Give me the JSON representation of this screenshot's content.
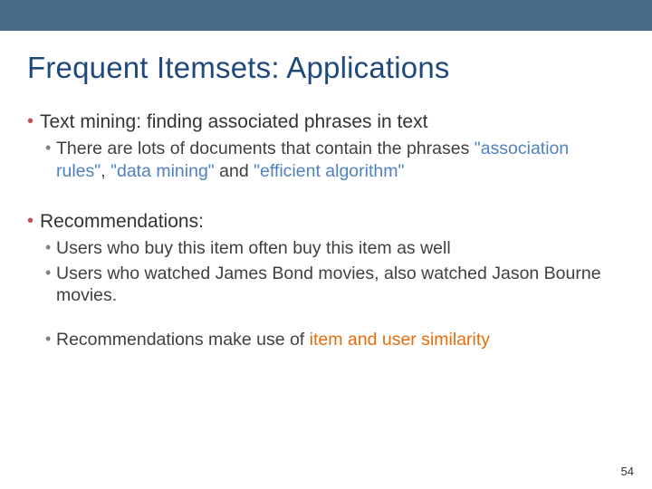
{
  "title": "Frequent Itemsets: Applications",
  "section1": {
    "heading": "Text mining: finding associated phrases in text",
    "sub1_pre": "There are lots of documents that contain the phrases ",
    "phrase1": "\"association rules\"",
    "sep1": ",  ",
    "phrase2": "\"data mining\"",
    "mid": " and ",
    "phrase3": "\"efficient algorithm\""
  },
  "section2": {
    "heading": "Recommendations:",
    "sub1": "Users who buy this item often buy this item as well",
    "sub2": "Users who watched James Bond movies, also watched Jason Bourne movies.",
    "sub3_pre": "Recommendations make use of ",
    "sub3_hl": "item and user similarity"
  },
  "page_number": "54"
}
